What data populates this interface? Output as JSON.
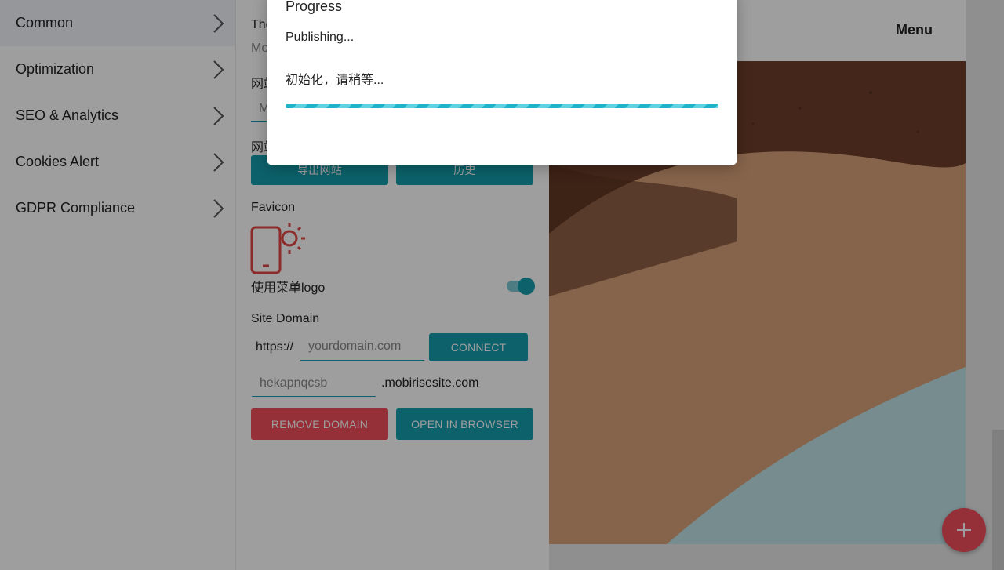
{
  "sidebar": {
    "items": [
      {
        "label": "Common"
      },
      {
        "label": "Optimization"
      },
      {
        "label": "SEO & Analytics"
      },
      {
        "label": "Cookies Alert"
      },
      {
        "label": "GDPR Compliance"
      }
    ]
  },
  "panel": {
    "partial_label_1": "The",
    "partial_label_2": "Mo",
    "partial_label_3": "网站",
    "partial_input": "M",
    "partial_label_4": "网站",
    "export_button": "导出网站",
    "history_button": "历史",
    "favicon_label": "Favicon",
    "menu_logo_label": "使用菜单logo",
    "menu_logo_enabled": true,
    "site_domain_label": "Site Domain",
    "https_prefix": "https://",
    "domain_placeholder": "yourdomain.com",
    "connect_button": "CONNECT",
    "subdomain_value": "hekapnqcsb",
    "subdomain_suffix": ".mobirisesite.com",
    "remove_domain_button": "REMOVE DOMAIN",
    "open_browser_button": "OPEN IN BROWSER"
  },
  "preview": {
    "menu_label": "Menu"
  },
  "modal": {
    "title": "Progress",
    "status": "Publishing...",
    "message": "初始化，请稍等..."
  },
  "colors": {
    "accent": "#149dac",
    "danger": "#f04c5b",
    "favicon": "#e04646"
  },
  "icons": {
    "sidebar_chevron": "chevron-right-icon",
    "favicon": "phone-sun-icon",
    "fab": "plus-icon"
  }
}
